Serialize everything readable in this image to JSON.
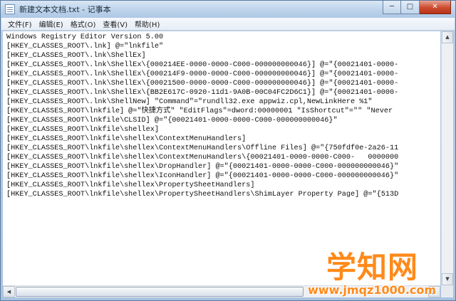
{
  "window": {
    "title": "新建文本文档.txt - 记事本",
    "minimize_glyph": "─",
    "maximize_glyph": "□",
    "close_glyph": "✕"
  },
  "menu": [
    {
      "label": "文件(F)"
    },
    {
      "label": "编辑(E)"
    },
    {
      "label": "格式(O)"
    },
    {
      "label": "查看(V)"
    },
    {
      "label": "帮助(H)"
    }
  ],
  "editor": {
    "lines": [
      "Windows Registry Editor Version 5.00",
      "[HKEY_CLASSES_ROOT\\.lnk] @=\"lnkfile\"",
      "[HKEY_CLASSES_ROOT\\.lnk\\ShellEx]",
      "[HKEY_CLASSES_ROOT\\.lnk\\ShellEx\\{000214EE-0000-0000-C000-000000000046}] @=\"{00021401-0000-",
      "[HKEY_CLASSES_ROOT\\.lnk\\ShellEx\\{000214F9-0000-0000-C000-000000000046}] @=\"{00021401-0000-",
      "[HKEY_CLASSES_ROOT\\.lnk\\ShellEx\\{00021500-0000-0000-C000-000000000046}] @=\"{00021401-0000-",
      "[HKEY_CLASSES_ROOT\\.lnk\\ShellEx\\{BB2E617C-0920-11d1-9A0B-00C04FC2D6C1}] @=\"{00021401-0000-",
      "[HKEY_CLASSES_ROOT\\.lnk\\ShellNew] \"Command\"=\"rundll32.exe appwiz.cpl,NewLinkHere %1\"",
      "[HKEY_CLASSES_ROOT\\lnkfile] @=\"快捷方式\" \"EditFlags\"=dword:00000001 \"IsShortcut\"=\"\" \"Never",
      "[HKEY_CLASSES_ROOT\\lnkfile\\CLSID] @=\"{00021401-0000-0000-C000-000000000046}\"",
      "[HKEY_CLASSES_ROOT\\lnkfile\\shellex]",
      "[HKEY_CLASSES_ROOT\\lnkfile\\shellex\\ContextMenuHandlers]",
      "[HKEY_CLASSES_ROOT\\lnkfile\\shellex\\ContextMenuHandlers\\Offline Files] @=\"{750fdf0e-2a26-11",
      "[HKEY_CLASSES_ROOT\\lnkfile\\shellex\\ContextMenuHandlers\\{00021401-0000-0000-C000-   0000000",
      "[HKEY_CLASSES_ROOT\\lnkfile\\shellex\\DropHandler] @=\"{00021401-0000-0000-C000-000000000046}\"",
      "[HKEY_CLASSES_ROOT\\lnkfile\\shellex\\IconHandler] @=\"{00021401-0000-0000-C000-000000000046}\"",
      "[HKEY_CLASSES_ROOT\\lnkfile\\shellex\\PropertySheetHandlers]",
      "[HKEY_CLASSES_ROOT\\lnkfile\\shellex\\PropertySheetHandlers\\ShimLayer Property Page] @=\"{513D"
    ]
  },
  "scrollbar": {
    "up_glyph": "▲",
    "down_glyph": "▼",
    "left_glyph": "◀",
    "right_glyph": "▶"
  },
  "watermark": {
    "logo_text": "学知网",
    "url": "www.jmqz1000.com"
  }
}
